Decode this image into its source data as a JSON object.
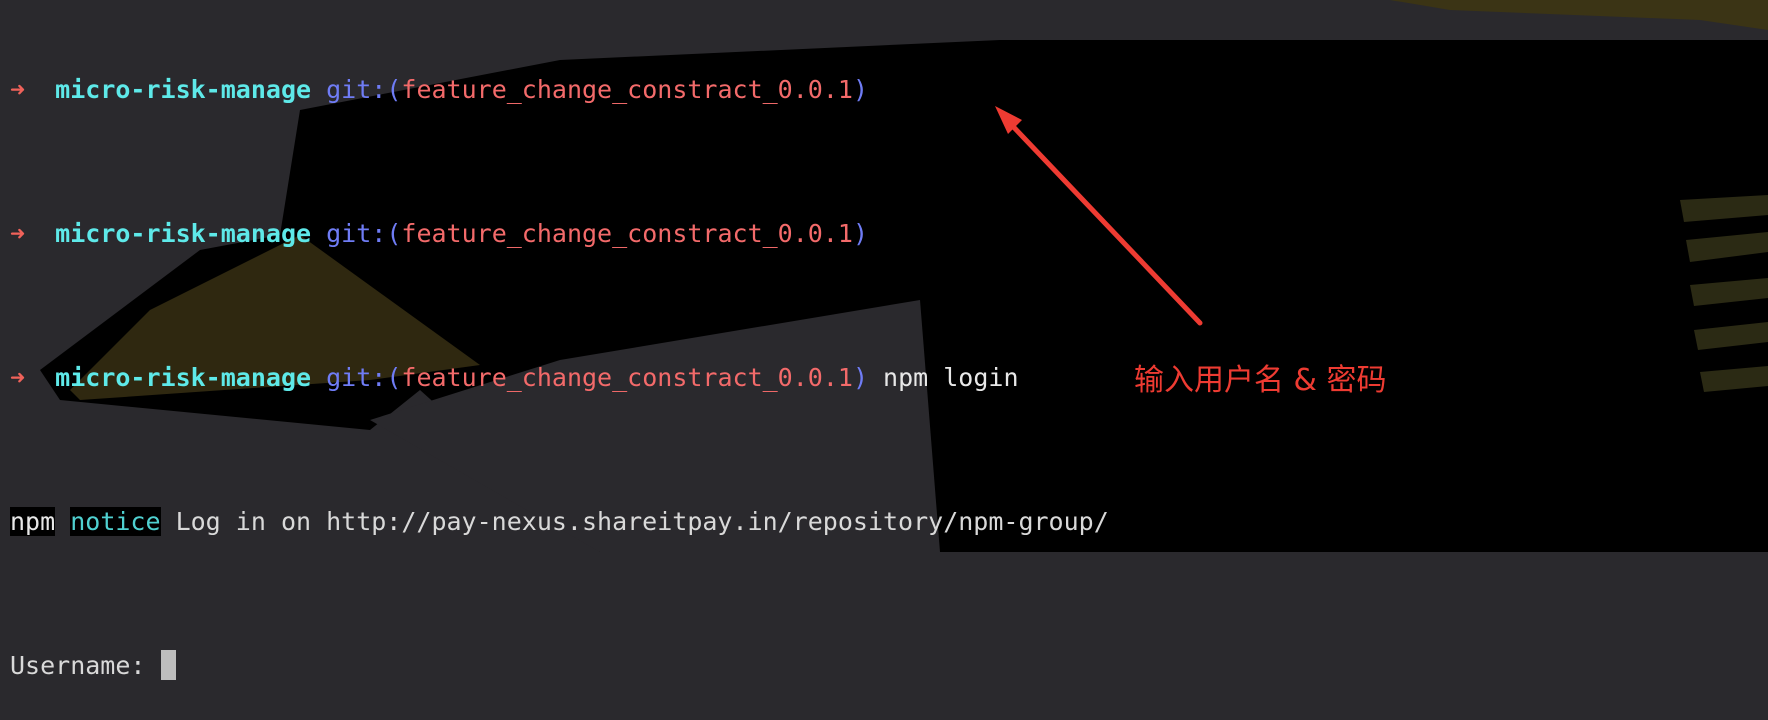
{
  "terminal": {
    "prompt_lines": [
      {
        "arrow": "➜",
        "dir": "micro-risk-manage",
        "git_label": "git:",
        "paren_open": "(",
        "branch": "feature_change_constract_0.0.1",
        "paren_close": ")",
        "command": ""
      },
      {
        "arrow": "➜",
        "dir": "micro-risk-manage",
        "git_label": "git:",
        "paren_open": "(",
        "branch": "feature_change_constract_0.0.1",
        "paren_close": ")",
        "command": ""
      },
      {
        "arrow": "➜",
        "dir": "micro-risk-manage",
        "git_label": "git:",
        "paren_open": "(",
        "branch": "feature_change_constract_0.0.1",
        "paren_close": ")",
        "command": " npm login"
      }
    ],
    "notice_line": {
      "npm": "npm",
      "notice": "notice",
      "message": " Log in on http://pay-nexus.shareitpay.in/repository/npm-group/"
    },
    "username_prompt": "Username: "
  },
  "annotation": {
    "text": "输入用户名 & 密码",
    "color": "#ee3b32"
  },
  "colors": {
    "background": "#2a292d",
    "prompt_arrow": "#f0625a",
    "dir": "#5ee9e9",
    "git": "#6f7cf5",
    "branch": "#f36a6a",
    "notice": "#4fd0d0"
  }
}
